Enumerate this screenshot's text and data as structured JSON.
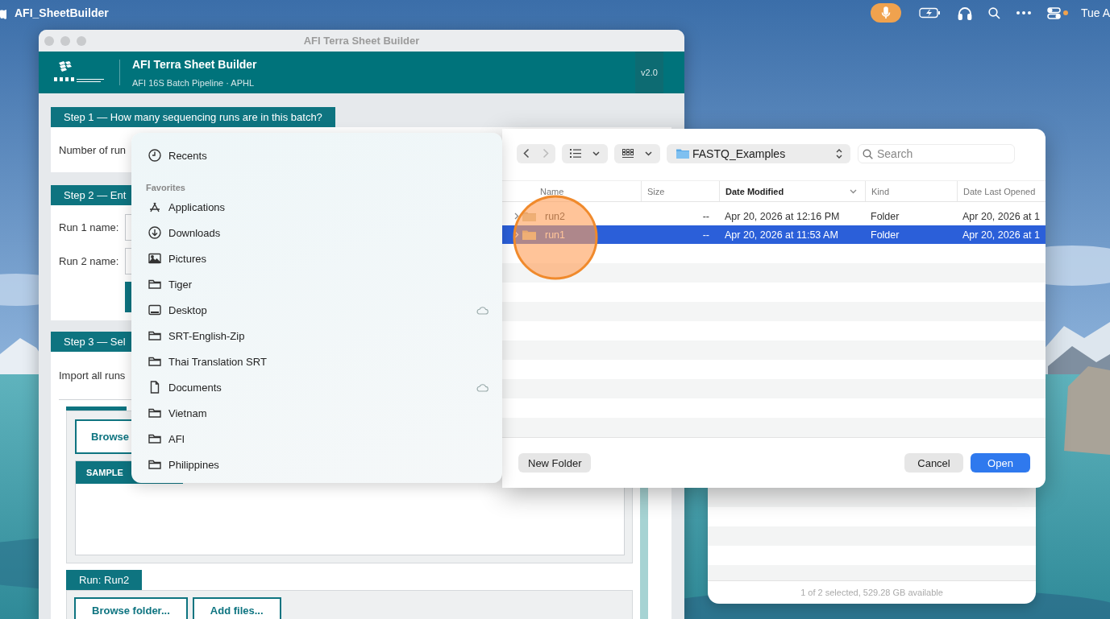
{
  "menubar": {
    "app_name": "AFI_SheetBuilder",
    "clock": "Tue A"
  },
  "app_window": {
    "title": "AFI Terra Sheet Builder",
    "header": {
      "title": "AFI Terra Sheet Builder",
      "subtitle": "AFI 16S Batch Pipeline · APHL",
      "version": "v2.0"
    },
    "step1": {
      "tab": "Step 1 — How many sequencing runs are in this batch?",
      "label": "Number of run"
    },
    "step2": {
      "tab": "Step 2 — Ent",
      "fields": [
        {
          "label": "Run 1 name:"
        },
        {
          "label": "Run 2 name:"
        }
      ]
    },
    "step3": {
      "tab": "Step 3 — Sel",
      "text": "Import all runs",
      "browse_button": "Browse",
      "table_header": "SAMPLE",
      "run2": {
        "tab": "Run: Run2",
        "buttons": [
          "Browse folder...",
          "Add files..."
        ]
      }
    }
  },
  "file_dialog": {
    "sidebar": {
      "top_items": [
        {
          "label": "Recents",
          "kind": "recents",
          "cloud": false
        }
      ],
      "section": "Favorites",
      "items": [
        {
          "label": "Applications",
          "kind": "apps",
          "cloud": false
        },
        {
          "label": "Downloads",
          "kind": "downloads",
          "cloud": false
        },
        {
          "label": "Pictures",
          "kind": "pictures",
          "cloud": false
        },
        {
          "label": "Tiger",
          "kind": "folder",
          "cloud": false
        },
        {
          "label": "Desktop",
          "kind": "desktop",
          "cloud": true
        },
        {
          "label": "SRT-English-Zip",
          "kind": "folder",
          "cloud": false
        },
        {
          "label": "Thai Translation SRT",
          "kind": "folder",
          "cloud": false
        },
        {
          "label": "Documents",
          "kind": "document",
          "cloud": true
        },
        {
          "label": "Vietnam",
          "kind": "folder",
          "cloud": false
        },
        {
          "label": "AFI",
          "kind": "folder",
          "cloud": false
        },
        {
          "label": "Philippines",
          "kind": "folder",
          "cloud": false
        }
      ]
    },
    "toolbar": {
      "location": "FASTQ_Examples",
      "search": {
        "placeholder": "Search"
      }
    },
    "columns": [
      {
        "label": "Name",
        "sorted": false
      },
      {
        "label": "Size",
        "sorted": false
      },
      {
        "label": "Date Modified",
        "sorted": true
      },
      {
        "label": "Kind",
        "sorted": false
      },
      {
        "label": "Date Last Opened",
        "sorted": false
      }
    ],
    "rows": [
      {
        "name": "run2",
        "size": "--",
        "modified": "Apr 20, 2026 at 12:16 PM",
        "file_kind": "Folder",
        "last_opened": "Apr 20, 2026 at 1",
        "selected": false
      },
      {
        "name": "run1",
        "size": "--",
        "modified": "Apr 20, 2026 at 11:53 AM",
        "file_kind": "Folder",
        "last_opened": "Apr 20, 2026 at 1",
        "selected": true
      }
    ],
    "buttons": {
      "new_folder": "New Folder",
      "cancel": "Cancel",
      "open": "Open"
    },
    "status": "1 of 2 selected, 529.28 GB available"
  }
}
